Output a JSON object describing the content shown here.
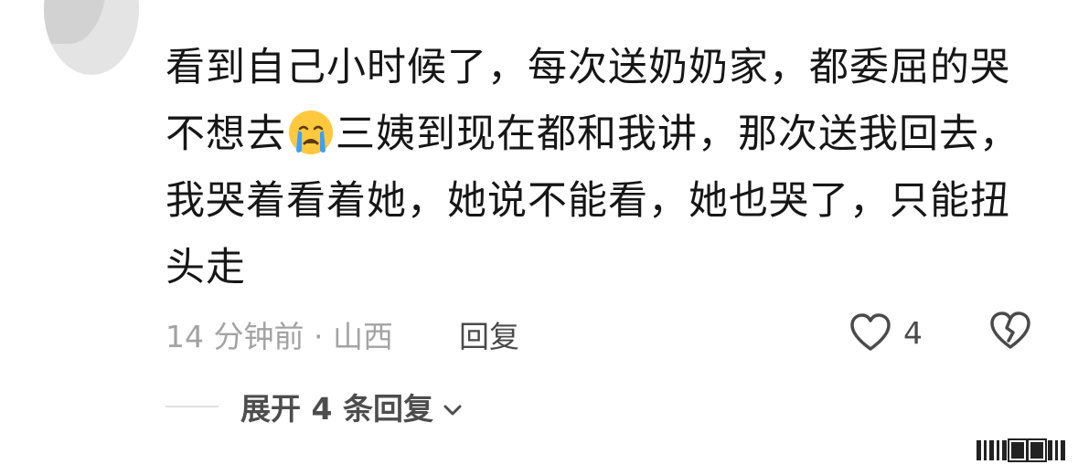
{
  "comment": {
    "lines": [
      "看到自己小时候了，每次送奶奶家，都委屈的哭",
      "三姨到现在都和我讲，那次送我回去，",
      "我哭着看着她，她说不能看，她也哭了，只能扭",
      "头走"
    ],
    "line2_before_emoji": "不想去",
    "emoji": "crying-face-emoji"
  },
  "meta": {
    "time": "14 分钟前",
    "separator": "·",
    "location": "山西",
    "reply_label": "回复"
  },
  "actions": {
    "like_count": "4",
    "like_icon": "heart-outline-icon",
    "dislike_icon": "broken-heart-icon"
  },
  "replies": {
    "expand_label": "展开 4 条回复",
    "expand_icon": "chevron-down-icon"
  },
  "colors": {
    "text": "#161616",
    "meta": "#a3a3a3",
    "action": "#4a4a4a",
    "emoji_face": "#ffc83d",
    "emoji_tears": "#3aa0ff"
  }
}
